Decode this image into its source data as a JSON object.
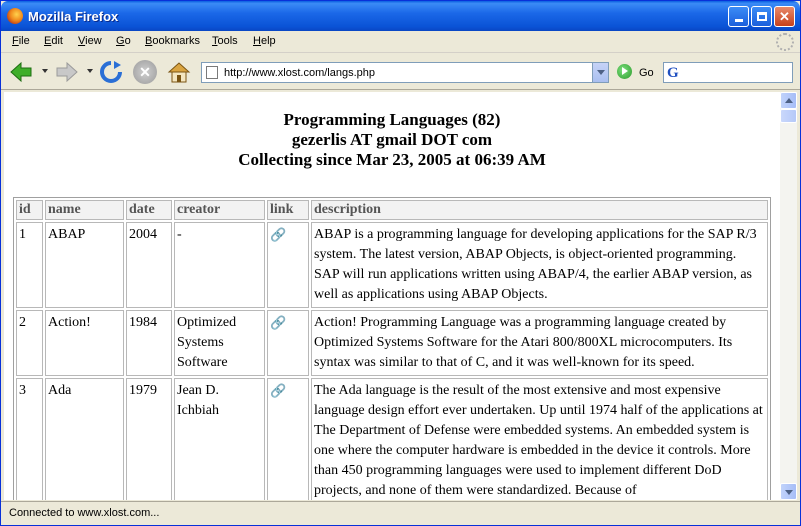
{
  "window": {
    "title": "Mozilla Firefox"
  },
  "menu": [
    {
      "label": "File",
      "mnemonic": "F",
      "rest": "ile"
    },
    {
      "label": "Edit",
      "mnemonic": "E",
      "rest": "dit"
    },
    {
      "label": "View",
      "mnemonic": "V",
      "rest": "iew"
    },
    {
      "label": "Go",
      "mnemonic": "G",
      "rest": "o"
    },
    {
      "label": "Bookmarks",
      "mnemonic": "B",
      "rest": "ookmarks"
    },
    {
      "label": "Tools",
      "mnemonic": "T",
      "rest": "ools"
    },
    {
      "label": "Help",
      "mnemonic": "H",
      "rest": "elp"
    }
  ],
  "toolbar": {
    "url": "http://www.xlost.com/langs.php",
    "go_label": "Go",
    "search_value": ""
  },
  "page": {
    "heading_line1": "Programming Languages (82)",
    "heading_line2": "gezerlis AT gmail DOT com",
    "heading_line3": "Collecting since Mar 23, 2005 at 06:39 AM",
    "columns": [
      "id",
      "name",
      "date",
      "creator",
      "link",
      "description"
    ],
    "rows": [
      {
        "id": "1",
        "name": "ABAP",
        "date": "2004",
        "creator": "-",
        "description": "ABAP is a programming language for developing applications for the SAP R/3 system. The latest version, ABAP Objects, is object-oriented programming. SAP will run applications written using ABAP/4, the earlier ABAP version, as well as applications using ABAP Objects."
      },
      {
        "id": "2",
        "name": "Action!",
        "date": "1984",
        "creator": "Optimized Systems Software",
        "description": "Action! Programming Language was a programming language created by Optimized Systems Software for the Atari 800/800XL microcomputers. Its syntax was similar to that of C, and it was well-known for its speed."
      },
      {
        "id": "3",
        "name": "Ada",
        "date": "1979",
        "creator": "Jean D. Ichbiah",
        "description": "The Ada language is the result of the most extensive and most expensive language design effort ever undertaken. Up until 1974 half of the applications at The Department of Defense were embedded systems. An embedded system is one where the computer hardware is embedded in the device it controls. More than 450 programming languages were used to implement different DoD projects, and none of them were standardized. Because of"
      }
    ]
  },
  "status": {
    "text": "Connected to www.xlost.com..."
  }
}
